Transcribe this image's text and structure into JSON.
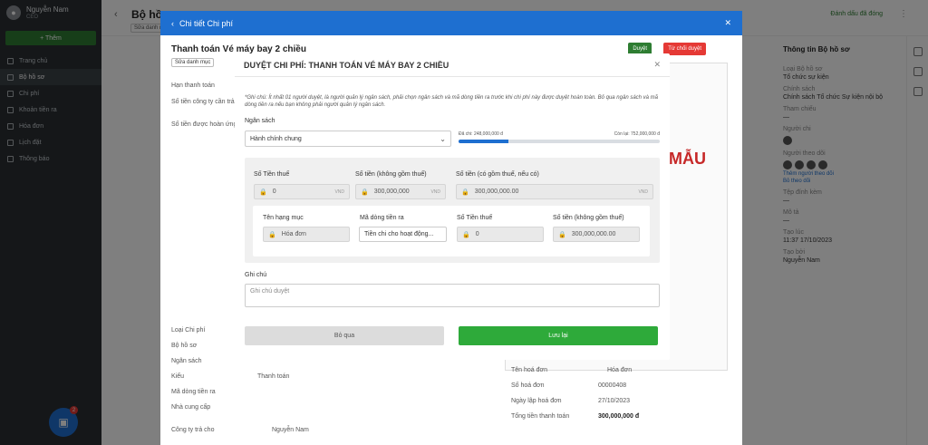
{
  "sidebar": {
    "user_name": "Nguyễn Nam",
    "user_role": "CEO",
    "add_label": "+ Thêm",
    "items": [
      {
        "label": "Trang chủ"
      },
      {
        "label": "Bộ hồ sơ"
      },
      {
        "label": "Chi phí"
      },
      {
        "label": "Khoản tiền ra"
      },
      {
        "label": "Hóa đơn"
      },
      {
        "label": "Lịch đặt"
      },
      {
        "label": "Thông báo"
      }
    ],
    "badge": "2"
  },
  "topbar": {
    "title": "Bộ hồ sơ...",
    "chip": "Sửa danh mục",
    "mark_label": "Đánh dấu đã đóng"
  },
  "right_panel": {
    "title": "Thông tin Bộ hồ sơ",
    "fields": [
      {
        "label": "Loại Bộ hồ sơ",
        "value": "Tổ chức sự kiện"
      },
      {
        "label": "Chính sách",
        "value": "Chính sách Tổ chức Sự kiện nội bộ"
      },
      {
        "label": "Tham chiếu",
        "value": "—"
      },
      {
        "label": "Người chi",
        "value": ""
      },
      {
        "label": "Người theo dõi",
        "value": ""
      },
      {
        "label": "Tệp đính kèm",
        "value": "—"
      },
      {
        "label": "Mô tả",
        "value": "—"
      },
      {
        "label": "Tạo lúc",
        "value": "11:37 17/10/2023"
      },
      {
        "label": "Tạo bởi",
        "value": "Nguyễn Nam"
      }
    ],
    "links": [
      "Thêm người theo dõi",
      "Bỏ theo dõi"
    ]
  },
  "drawer": {
    "header": "Chi tiết Chi phí",
    "title": "Thanh toán Vé máy bay 2 chiều",
    "tag": "Sửa danh mục",
    "approve_label": "Duyệt",
    "reject_label": "Từ chối duyệt",
    "rows": [
      "Hạn thanh toán",
      "Số tiền công ty cần trả",
      "Số tiền được hoàn ứng",
      "Loại Chi phí",
      "Bộ hồ sơ",
      "Ngân sách",
      "Kiểu",
      "Mã dòng tiền ra",
      "Nhà cung cấp",
      "Công ty trả cho"
    ],
    "kieu_value": "Thanh toán",
    "company_pay_value": "Nguyễn Nam",
    "invoice_name_label": "Tên hoá đơn",
    "invoice_name_value": "Hóa đơn",
    "invoice_no_label": "Số hoá đơn",
    "invoice_no_value": "00000408",
    "invoice_date_label": "Ngày lập hoá đơn",
    "invoice_date_value": "27/10/2023",
    "invoice_total_label": "Tổng tiền thanh toán",
    "invoice_total_value": "300,000,000 đ",
    "stamp": "MẪU"
  },
  "modal": {
    "title": "DUYỆT CHI PHÍ: THANH TOÁN VÉ MÁY BAY 2 CHIỀU",
    "note": "*Ghi chú: Ít nhất 01 người duyệt, là người quản lý ngân sách, phải chọn ngân sách và mã dòng tiền ra trước khi chi phí này được duyệt hoàn toàn. Bỏ qua ngân sách và mã dòng tiền ra nếu bạn không phải người quản lý ngân sách.",
    "budget_label": "Ngân sách",
    "budget_value": "Hành chính chung",
    "spent_label": "Đã chi: 248,000,000 đ",
    "remaining_label": "Còn lại: 752,000,000 đ",
    "spent_fraction": 0.248,
    "tax_label": "Số Tiền thuế",
    "tax_value": "0",
    "amount_excl_label": "Số tiền (không gồm thuế)",
    "amount_excl_value": "300,000,000",
    "amount_incl_label": "Số tiền (có gồm thuế, nếu có)",
    "amount_incl_value": "300,000,000.00",
    "currency": "VND",
    "item_name_label": "Tên hạng mục",
    "item_name_value": "Hóa đơn",
    "cashflow_label": "Mã dòng tiền ra",
    "cashflow_value": "Tiền chi cho hoạt động...",
    "item_tax_label": "Số Tiền thuế",
    "item_tax_value": "0",
    "item_amount_label": "Số tiền (không gồm thuế)",
    "item_amount_value": "300,000,000.00",
    "note_label": "Ghi chú",
    "note_placeholder": "Ghi chú duyệt",
    "skip_label": "Bỏ qua",
    "save_label": "Lưu lại"
  }
}
